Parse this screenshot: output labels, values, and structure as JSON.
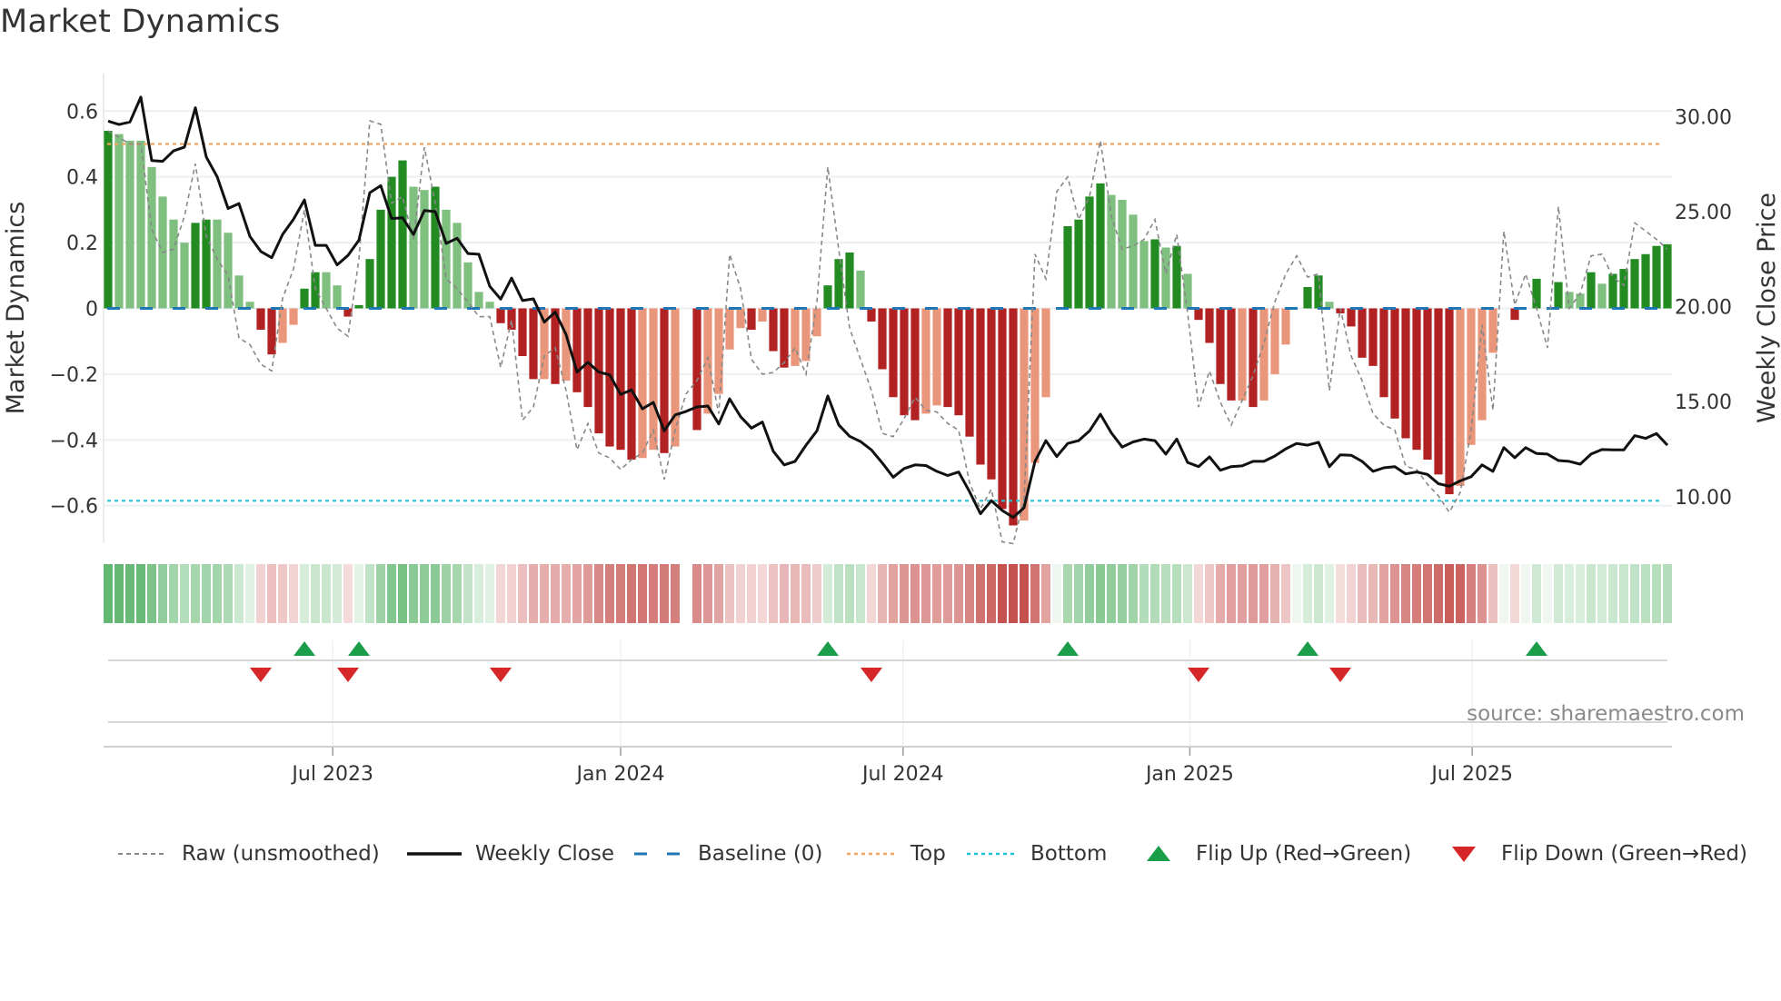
{
  "title": "Market Dynamics",
  "source": "source: sharemaestro.com",
  "legend": [
    {
      "label": "Raw (unsmoothed)",
      "icon": "dashed-gray-line"
    },
    {
      "label": "Weekly Close",
      "icon": "solid-black-line"
    },
    {
      "label": "Baseline (0)",
      "icon": "dashed-blue-line"
    },
    {
      "label": "Top",
      "icon": "dotted-orange-line"
    },
    {
      "label": "Bottom",
      "icon": "dotted-cyan-line"
    },
    {
      "label": "Flip Up (Red→Green)",
      "icon": "up-triangle-icon"
    },
    {
      "label": "Flip Down (Green→Red)",
      "icon": "down-triangle-icon"
    }
  ],
  "colors": {
    "pos_strong": "#228b22",
    "pos_weak": "#7fbf7f",
    "neg_strong": "#b22222",
    "neg_weak": "#e9967a",
    "baseline": "#1f77b4",
    "top": "#f4a460",
    "bottom": "#22c3d6",
    "raw": "#888888",
    "close": "#111111",
    "flip_up": "#1a9e4a",
    "flip_down": "#d62728"
  },
  "chart_data": {
    "type": "bar",
    "title": "Market Dynamics",
    "ylabel": "Market Dynamics",
    "y2label": "Weekly Close Price",
    "ylim": [
      -0.714,
      0.714
    ],
    "y2lim": [
      7.55,
      32.27
    ],
    "yticks": [
      "0.6",
      "0.4",
      "0.2",
      "0",
      "−0.2",
      "−0.4",
      "−0.6"
    ],
    "ytick_values": [
      0.6,
      0.4,
      0.2,
      0,
      -0.2,
      -0.4,
      -0.6
    ],
    "y2ticks": [
      "30.00",
      "25.00",
      "20.00",
      "15.00",
      "10.00"
    ],
    "y2tick_values": [
      30,
      25,
      20,
      15,
      10
    ],
    "xticks": [
      {
        "label": "Jul 2023",
        "week": 20.6
      },
      {
        "label": "Jan 2024",
        "week": 47.0
      },
      {
        "label": "Jul 2024",
        "week": 72.9
      },
      {
        "label": "Jan 2025",
        "week": 99.2
      },
      {
        "label": "Jul 2025",
        "week": 125.1
      }
    ],
    "top_level": 0.5,
    "bottom_level": -0.585,
    "baseline": 0,
    "grid": true,
    "legend_position": "bottom",
    "dynamics": [
      0.54,
      0.53,
      0.51,
      0.51,
      0.43,
      0.34,
      0.27,
      0.2,
      0.26,
      0.27,
      0.27,
      0.23,
      0.1,
      0.02,
      -0.065,
      -0.14,
      -0.105,
      -0.05,
      0.06,
      0.11,
      0.11,
      0.07,
      -0.025,
      0.01,
      0.15,
      0.3,
      0.4,
      0.45,
      0.37,
      0.36,
      0.37,
      0.3,
      0.26,
      0.14,
      0.05,
      0.02,
      -0.045,
      -0.065,
      -0.145,
      -0.215,
      -0.215,
      -0.23,
      -0.22,
      -0.255,
      -0.3,
      -0.38,
      -0.42,
      -0.43,
      -0.46,
      -0.455,
      -0.43,
      -0.44,
      -0.42,
      null,
      -0.37,
      -0.32,
      -0.26,
      -0.125,
      -0.06,
      -0.065,
      -0.04,
      -0.13,
      -0.18,
      -0.175,
      -0.16,
      -0.085,
      0.07,
      0.15,
      0.17,
      0.115,
      -0.04,
      -0.185,
      -0.27,
      -0.325,
      -0.34,
      -0.32,
      -0.295,
      -0.3,
      -0.325,
      -0.39,
      -0.475,
      -0.52,
      -0.61,
      -0.66,
      -0.645,
      -0.47,
      -0.27,
      0,
      0.25,
      0.27,
      0.34,
      0.38,
      0.345,
      0.33,
      0.285,
      0.205,
      0.21,
      0.185,
      0.19,
      0.105,
      -0.035,
      -0.105,
      -0.23,
      -0.28,
      -0.28,
      -0.3,
      -0.28,
      -0.2,
      -0.11,
      0,
      0.065,
      0.1,
      0.02,
      -0.015,
      -0.055,
      -0.15,
      -0.175,
      -0.27,
      -0.335,
      -0.395,
      -0.43,
      -0.46,
      -0.505,
      -0.565,
      -0.54,
      -0.415,
      -0.34,
      -0.135,
      0,
      -0.035,
      0,
      0.09,
      0,
      0.08,
      0.05,
      0.045,
      0.11,
      0.075,
      0.105,
      0.12,
      0.15,
      0.165,
      0.19,
      0.195
    ],
    "raw": [
      0.54,
      0.52,
      0.5,
      0.5,
      0.24,
      0.17,
      0.18,
      0.28,
      0.44,
      0.22,
      0.15,
      0.1,
      -0.09,
      -0.11,
      -0.17,
      -0.19,
      0.03,
      0.12,
      0.3,
      0.06,
      0,
      -0.06,
      -0.085,
      0.15,
      0.57,
      0.56,
      0.32,
      0.34,
      0.21,
      0.49,
      0.32,
      0.09,
      0.06,
      0.02,
      -0.025,
      -0.025,
      -0.18,
      -0.035,
      -0.34,
      -0.3,
      -0.145,
      -0.12,
      -0.25,
      -0.43,
      -0.35,
      -0.44,
      -0.455,
      -0.49,
      -0.46,
      -0.44,
      -0.37,
      -0.52,
      -0.37,
      -0.26,
      -0.22,
      -0.15,
      -0.32,
      0.165,
      0.06,
      -0.155,
      -0.2,
      -0.195,
      -0.165,
      -0.12,
      -0.2,
      0.02,
      0.43,
      0.18,
      -0.06,
      -0.155,
      -0.25,
      -0.38,
      -0.39,
      -0.335,
      -0.27,
      -0.31,
      -0.315,
      -0.35,
      -0.37,
      -0.53,
      -0.61,
      -0.55,
      -0.71,
      -0.715,
      -0.58,
      0.165,
      0.09,
      0.355,
      0.4,
      0.27,
      0.34,
      0.51,
      0.28,
      0.18,
      0.19,
      0.21,
      0.27,
      0.105,
      0.225,
      -0.015,
      -0.3,
      -0.19,
      -0.285,
      -0.355,
      -0.28,
      -0.205,
      -0.105,
      0.02,
      0.105,
      0.16,
      0.095,
      0.105,
      -0.25,
      0,
      -0.145,
      -0.22,
      -0.32,
      -0.355,
      -0.37,
      -0.48,
      -0.49,
      -0.535,
      -0.57,
      -0.62,
      -0.56,
      -0.37,
      -0.05,
      -0.31,
      0.235,
      0.01,
      0.105,
      0,
      -0.12,
      0.31,
      0,
      0.045,
      0.16,
      0.165,
      0.095,
      0.07,
      0.26,
      0.235,
      0.21,
      0.18
    ],
    "weekly_close": [
      29.77,
      29.59,
      29.72,
      31.03,
      27.69,
      27.65,
      28.2,
      28.4,
      30.47,
      27.88,
      26.84,
      25.17,
      25.43,
      23.7,
      22.91,
      22.58,
      23.8,
      24.6,
      25.62,
      23.23,
      23.23,
      22.2,
      22.7,
      23.5,
      26.0,
      26.37,
      24.64,
      24.68,
      23.8,
      25.06,
      25.0,
      23.33,
      23.6,
      22.8,
      22.76,
      21.07,
      20.4,
      21.5,
      20.32,
      20.41,
      19.19,
      19.72,
      18.53,
      16.56,
      17.07,
      16.56,
      16.41,
      15.38,
      15.62,
      14.62,
      14.96,
      13.46,
      14.3,
      14.49,
      14.72,
      14.77,
      13.83,
      15.15,
      14.21,
      13.61,
      13.93,
      12.39,
      11.67,
      11.86,
      12.71,
      13.46,
      15.3,
      13.78,
      13.18,
      12.9,
      12.46,
      11.77,
      11.02,
      11.48,
      11.67,
      11.64,
      11.33,
      11.11,
      11.3,
      10.26,
      9.1,
      9.79,
      9.27,
      8.91,
      9.42,
      11.86,
      12.95,
      12.11,
      12.8,
      12.95,
      13.46,
      14.34,
      13.36,
      12.61,
      12.88,
      13.03,
      12.95,
      12.24,
      13.03,
      11.8,
      11.58,
      12.09,
      11.39,
      11.58,
      11.62,
      11.86,
      11.86,
      12.14,
      12.52,
      12.8,
      12.71,
      12.86,
      11.58,
      12.2,
      12.18,
      11.86,
      11.33,
      11.52,
      11.58,
      11.2,
      11.3,
      11.17,
      10.68,
      10.55,
      10.83,
      11.05,
      11.67,
      11.33,
      12.58,
      12.05,
      12.58,
      12.27,
      12.24,
      11.9,
      11.86,
      11.71,
      12.24,
      12.48,
      12.46,
      12.46,
      13.21,
      13.07,
      13.32,
      12.71
    ]
  }
}
